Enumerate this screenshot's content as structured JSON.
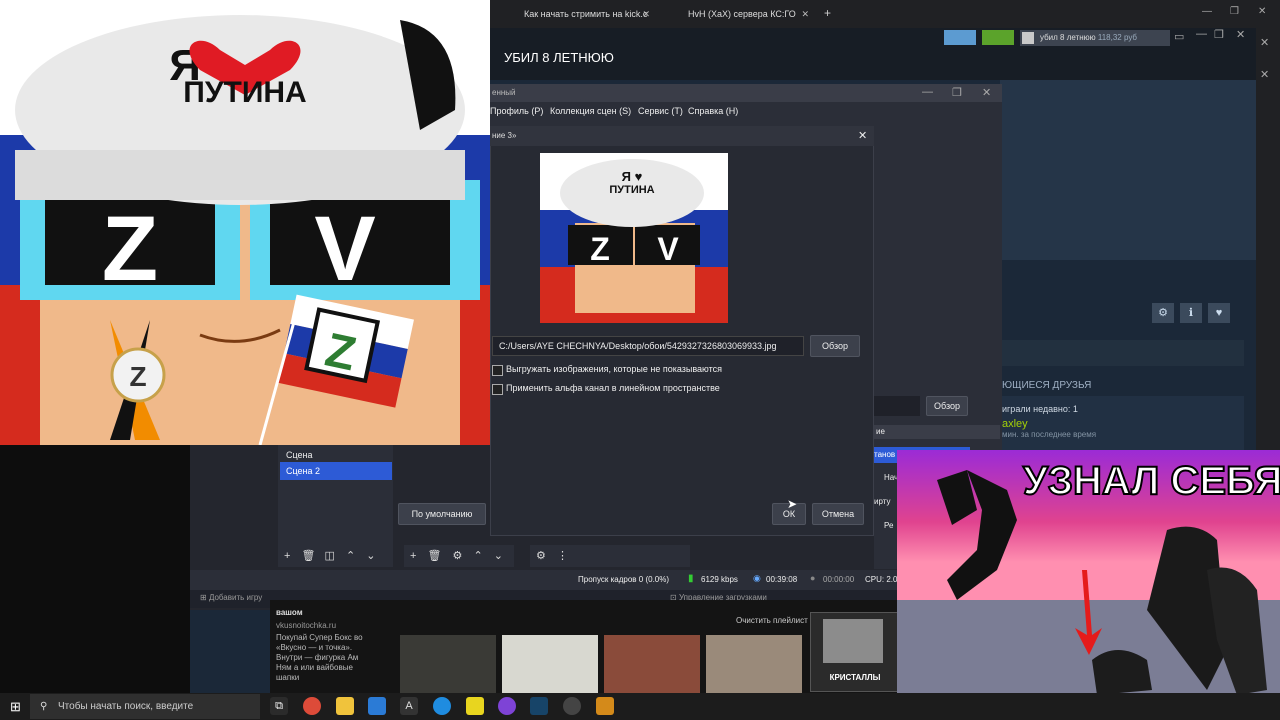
{
  "browser": {
    "tabs": [
      {
        "label": "Как начать стримить на kick.c"
      },
      {
        "label": "HvH (XaX) сервера КС:ГО"
      }
    ],
    "new_tab": "+"
  },
  "steam": {
    "profile_name": "УБИЛ 8 ЛЕТНЮЮ",
    "user": "убил 8 летнюю",
    "balance": "118,32 руб",
    "friends_header": "ЮЩИЕСЯ ДРУЗЬЯ",
    "played_recently": "играли недавно: 1",
    "friend_name": "axley",
    "friend_sub": "мин. за последнее время",
    "add_game": "Добавить игру",
    "downloads": "Управление загрузками"
  },
  "obs": {
    "title_fragment": "енный",
    "menu": [
      "Профиль (P)",
      "Коллекция сцен (S)",
      "Сервис (T)",
      "Справка (H)"
    ],
    "dialog_title": "ние 3»",
    "path": "C:/Users/AYE CHECHNYA/Desktop/обои/5429327326803069933.jpg",
    "browse": "Обзор",
    "browse2": "Обзор",
    "opt_unload": "Выгружать изображения, которые не показываются",
    "opt_alpha": "Применить альфа канал в линейном пространстве",
    "defaults": "По умолчанию",
    "ok": "ОК",
    "cancel": "Отмена",
    "scenes": [
      "Сцена",
      "Сцена 2"
    ],
    "status": {
      "dropped": "Пропуск кадров 0 (0.0%)",
      "bitrate": "6129 kbps",
      "stream_time": "00:39:08",
      "rec_time": "00:00:00",
      "cpu": "CPU: 2.0"
    },
    "right_panel": {
      "header": "ие",
      "row1": "танов",
      "row2": "Нач",
      "row3": "ирту",
      "row4": "Ре"
    }
  },
  "music": {
    "ad_title": "вашом",
    "ad_site": "vkusnoitochka.ru",
    "ad_text": "Покупай Супер Бокс во «Вкусно — и точка». Внутри — фигурка Ам Ням а или вайбовые шапки",
    "clear_playlist": "Очистить плейлист",
    "album_label": "КРИСТАЛЛЫ"
  },
  "meme_left": {
    "cap_line1": "Я",
    "cap_line2": "ПУТИНА",
    "letters": [
      "Z",
      "V"
    ],
    "flag_letter": "Z"
  },
  "meme_right": {
    "caption": "УЗНАЛ СЕБЯ?"
  },
  "taskbar": {
    "search_placeholder": "Чтобы начать поиск, введите"
  },
  "colors": {
    "steam_bg": "#1b2838",
    "obs_bg": "#2b2e38",
    "selected_scene": "#2d5bd6",
    "russia_white": "#ffffff",
    "russia_blue": "#1c3aa9",
    "russia_red": "#d52b1e"
  }
}
